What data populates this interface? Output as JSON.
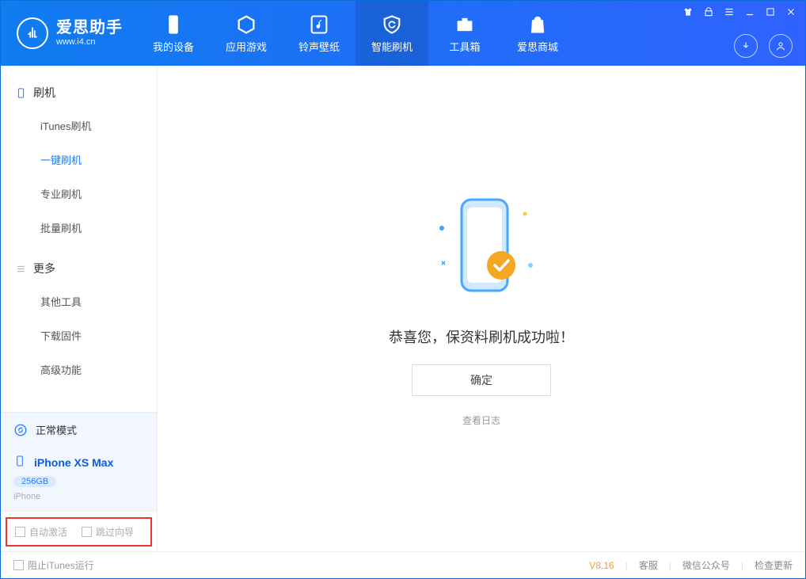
{
  "brand": {
    "name": "爱思助手",
    "url": "www.i4.cn"
  },
  "topnav": {
    "items": [
      {
        "label": "我的设备",
        "name": "nav-my-device"
      },
      {
        "label": "应用游戏",
        "name": "nav-apps"
      },
      {
        "label": "铃声壁纸",
        "name": "nav-ringtones"
      },
      {
        "label": "智能刷机",
        "name": "nav-smart-flash"
      },
      {
        "label": "工具箱",
        "name": "nav-toolbox"
      },
      {
        "label": "爱思商城",
        "name": "nav-store"
      }
    ],
    "activeIndex": 3
  },
  "sidebar": {
    "section1": {
      "title": "刷机",
      "items": [
        {
          "label": "iTunes刷机"
        },
        {
          "label": "一键刷机"
        },
        {
          "label": "专业刷机"
        },
        {
          "label": "批量刷机"
        }
      ],
      "activeIndex": 1
    },
    "section2": {
      "title": "更多",
      "items": [
        {
          "label": "其他工具"
        },
        {
          "label": "下载固件"
        },
        {
          "label": "高级功能"
        }
      ]
    },
    "mode": "正常模式",
    "device": {
      "name": "iPhone XS Max",
      "storage": "256GB",
      "type": "iPhone"
    },
    "checks": {
      "autoActivate": "自动激活",
      "skipGuide": "跳过向导"
    }
  },
  "main": {
    "title": "恭喜您，保资料刷机成功啦！",
    "okButton": "确定",
    "logLink": "查看日志"
  },
  "statusbar": {
    "blockItunes": "阻止iTunes运行",
    "version": "V8.16",
    "links": {
      "support": "客服",
      "wechat": "微信公众号",
      "update": "检查更新"
    }
  }
}
